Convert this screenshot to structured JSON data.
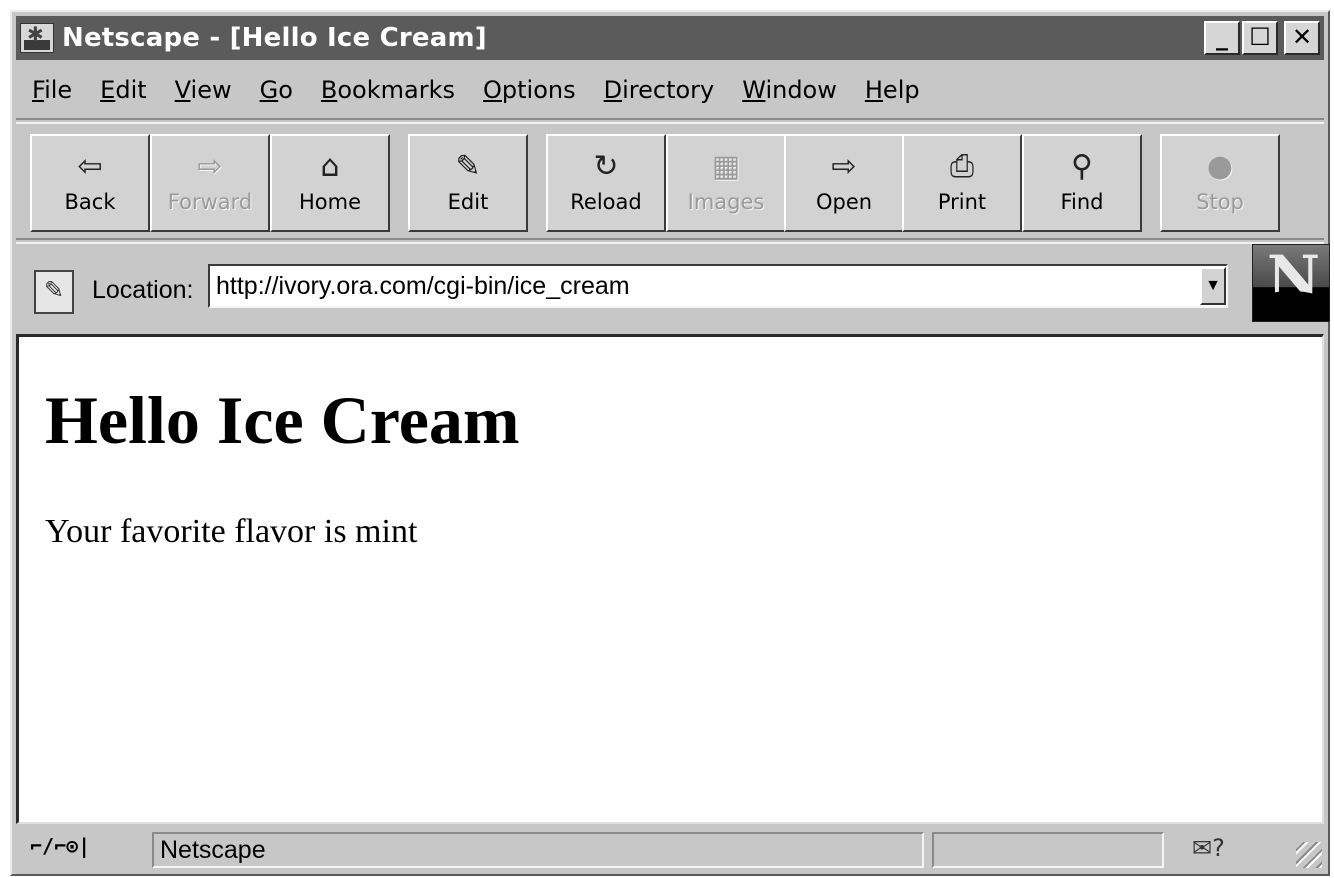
{
  "window": {
    "title": "Netscape - [Hello Ice Cream]",
    "controls": {
      "minimize": "_",
      "maximize": "☐",
      "close": "✕"
    }
  },
  "menu": [
    {
      "key": "F",
      "rest": "ile"
    },
    {
      "key": "E",
      "rest": "dit"
    },
    {
      "key": "V",
      "rest": "iew"
    },
    {
      "key": "G",
      "rest": "o"
    },
    {
      "key": "B",
      "rest": "ookmarks"
    },
    {
      "key": "O",
      "rest": "ptions"
    },
    {
      "key": "D",
      "rest": "irectory"
    },
    {
      "key": "W",
      "rest": "indow"
    },
    {
      "key": "H",
      "rest": "elp"
    }
  ],
  "toolbar": {
    "back": {
      "label": "Back",
      "icon": "⇦"
    },
    "forward": {
      "label": "Forward",
      "icon": "⇨"
    },
    "home": {
      "label": "Home",
      "icon": "⌂"
    },
    "edit": {
      "label": "Edit",
      "icon": "✎"
    },
    "reload": {
      "label": "Reload",
      "icon": "↻"
    },
    "images": {
      "label": "Images",
      "icon": "▦"
    },
    "open": {
      "label": "Open",
      "icon": "⇨"
    },
    "print": {
      "label": "Print",
      "icon": "⎙"
    },
    "find": {
      "label": "Find",
      "icon": "⚲"
    },
    "stop": {
      "label": "Stop",
      "icon": "●"
    }
  },
  "location": {
    "label": "Location:",
    "url": "http://ivory.ora.com/cgi-bin/ice_cream",
    "dropdown_icon": "▼",
    "logo_letter": "N"
  },
  "page": {
    "heading": "Hello Ice Cream",
    "text": "Your favorite flavor is  mint"
  },
  "status": {
    "security_glyph": "⌐/⌐⊙|",
    "message": "Netscape",
    "mail_glyph": "✉?"
  }
}
